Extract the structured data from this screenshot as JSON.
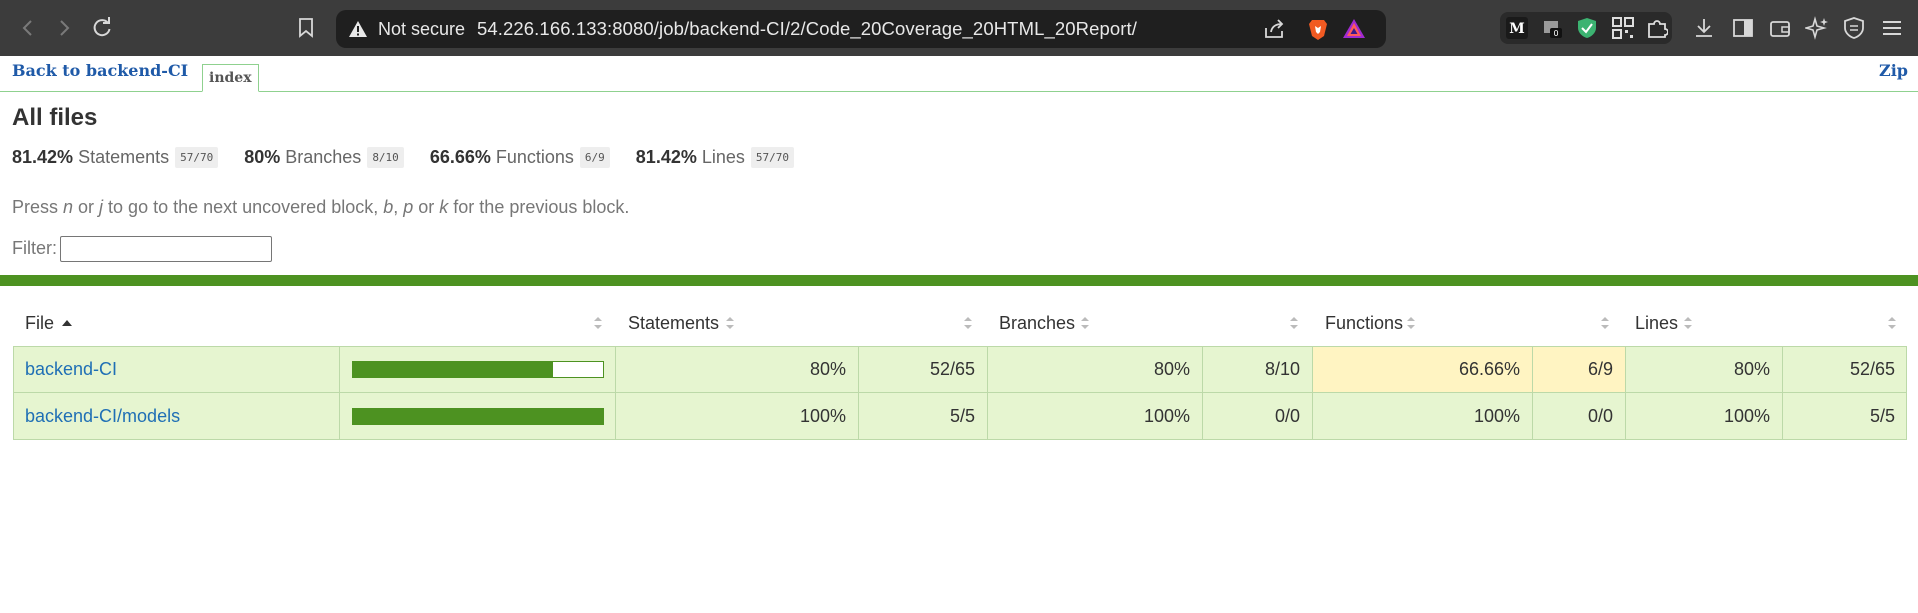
{
  "browser": {
    "security_label": "Not secure",
    "url": "54.226.166.133:8080/job/backend-CI/2/Code_20Coverage_20HTML_20Report/",
    "notification_count": "0",
    "ext_m_letter": "M"
  },
  "topbar": {
    "back_label": "Back to backend-CI",
    "index_tab": "index",
    "zip_label": "Zip"
  },
  "page": {
    "title": "All files",
    "summary": [
      {
        "pct": "81.42%",
        "label": "Statements",
        "frac": "57/70"
      },
      {
        "pct": "80%",
        "label": "Branches",
        "frac": "8/10"
      },
      {
        "pct": "66.66%",
        "label": "Functions",
        "frac": "6/9"
      },
      {
        "pct": "81.42%",
        "label": "Lines",
        "frac": "57/70"
      }
    ],
    "hint": {
      "p1": "Press ",
      "k1": "n",
      "p2": " or ",
      "k2": "j",
      "p3": " to go to the next uncovered block, ",
      "k3": "b",
      "p4": ", ",
      "k4": "p",
      "p5": " or ",
      "k5": "k",
      "p6": " for the previous block."
    },
    "filter_label": "Filter:",
    "filter_value": ""
  },
  "table": {
    "headers": {
      "file": "File",
      "statements": "Statements",
      "branches": "Branches",
      "functions": "Functions",
      "lines": "Lines"
    },
    "rows": [
      {
        "file": "backend-CI",
        "coverage_fraction": 0.8,
        "statements_pct": "80%",
        "statements_frac": "52/65",
        "branches_pct": "80%",
        "branches_frac": "8/10",
        "functions_pct": "66.66%",
        "functions_frac": "6/9",
        "lines_pct": "80%",
        "lines_frac": "52/65"
      },
      {
        "file": "backend-CI/models",
        "coverage_fraction": 1.0,
        "statements_pct": "100%",
        "statements_frac": "5/5",
        "branches_pct": "100%",
        "branches_frac": "0/0",
        "functions_pct": "100%",
        "functions_frac": "0/0",
        "lines_pct": "100%",
        "lines_frac": "5/5"
      }
    ]
  },
  "colors": {
    "high": "#e6f5d0",
    "medium": "#fff4c2",
    "bar": "#4d9221",
    "link": "#1f6fb5"
  }
}
